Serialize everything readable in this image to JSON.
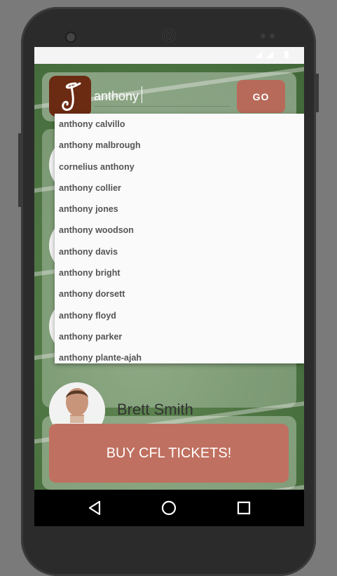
{
  "search": {
    "value": "anthony",
    "go_label": "GO"
  },
  "suggestions": [
    "anthony calvillo",
    "anthony malbrough",
    "cornelius anthony",
    "anthony collier",
    "anthony jones",
    "anthony woodson",
    "anthony davis",
    "anthony bright",
    "anthony dorsett",
    "anthony floyd",
    "anthony parker",
    "anthony plante-ajah"
  ],
  "player_peek": {
    "name": "Brett Smith"
  },
  "tickets": {
    "label": "BUY CFL TICKETS!"
  },
  "colors": {
    "go_button": "#b86a5a",
    "tickets_button": "#c07060",
    "logo_bg": "#6b2a12"
  },
  "icons": {
    "back": "back-triangle-icon",
    "home": "home-circle-icon",
    "recents": "recents-square-icon"
  }
}
